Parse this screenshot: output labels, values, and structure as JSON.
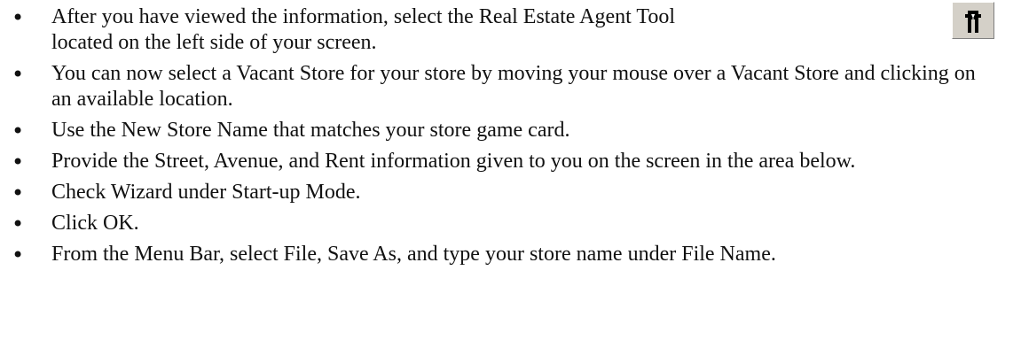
{
  "bullets": [
    "After you have viewed the information, select the Real Estate Agent Tool located on the left side of your screen.",
    "You can now select a Vacant Store for your store by moving your mouse over a Vacant Store and clicking on an available location.",
    "Use the New Store Name that matches your store game card.",
    "Provide the Street, Avenue, and Rent information given to you on the screen in the area below.",
    "Check Wizard under Start-up Mode.",
    "Click OK.",
    "From the Menu Bar, select File, Save As, and type your store name under File Name."
  ],
  "icon": {
    "name": "real-estate-agent-tool-icon",
    "background": "#d4d0c8",
    "foreground": "#000000"
  }
}
